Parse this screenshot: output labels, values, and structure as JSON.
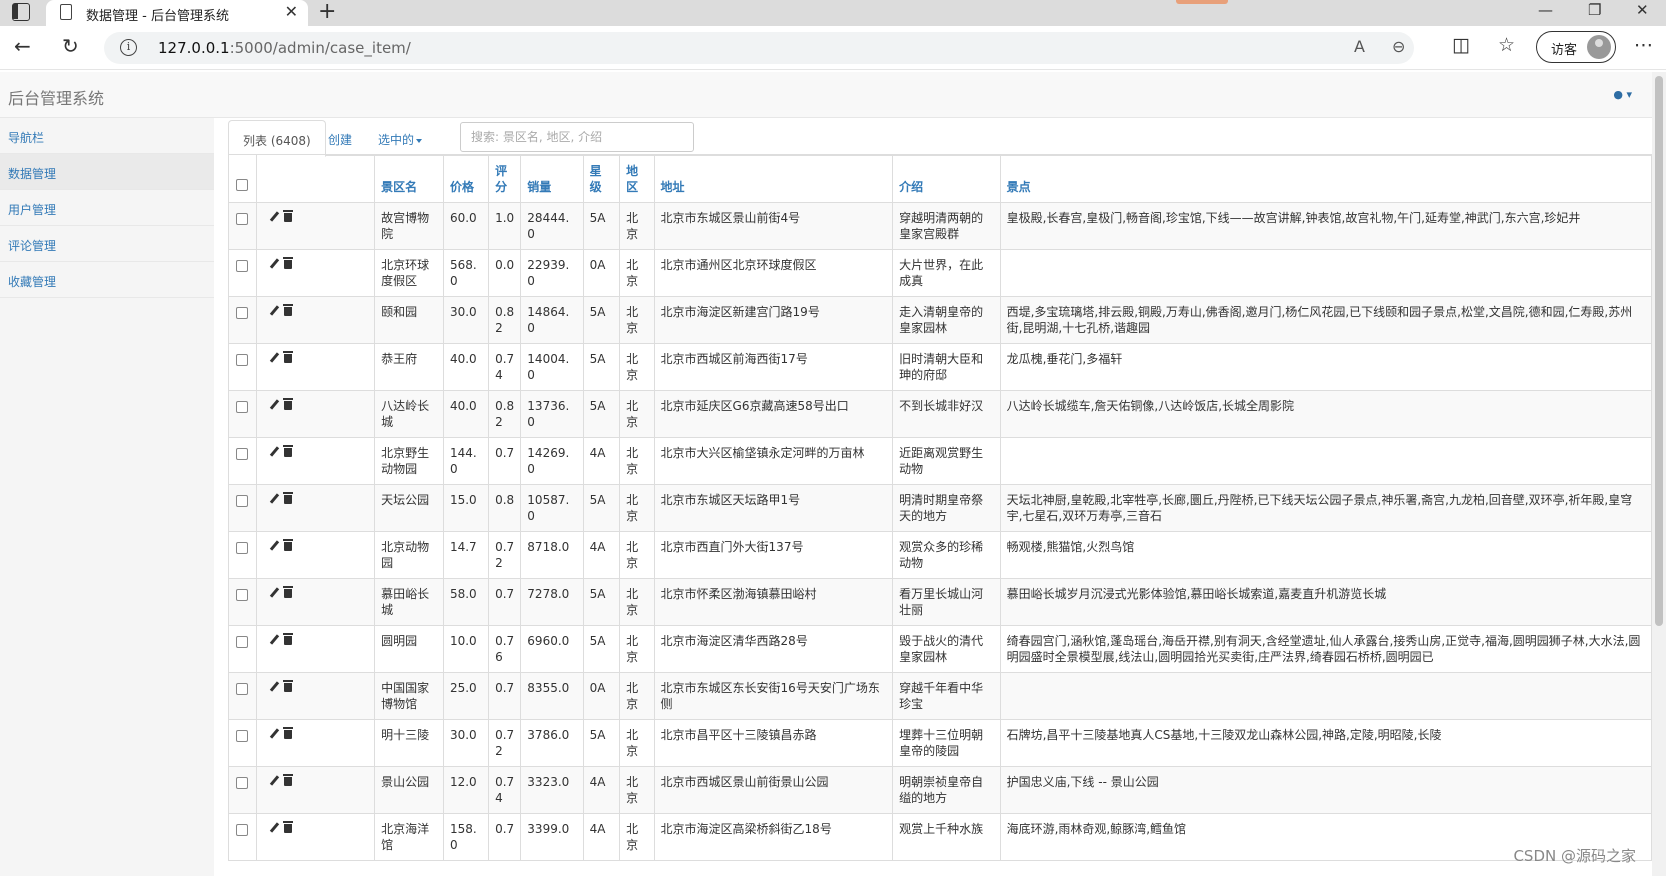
{
  "browser": {
    "tab_title": "数据管理 - 后台管理系统",
    "tab_close": "✕",
    "new_tab": "+",
    "url_host": "127.0.0.1",
    "url_path": ":5000/admin/case_item/",
    "guest_label": "访客",
    "icons": [
      "back-icon",
      "refresh-icon",
      "info-icon",
      "read-aloud-icon",
      "zoom-icon",
      "split-screen-icon",
      "favorites-icon",
      "more-icon"
    ]
  },
  "app": {
    "brand": "后台管理系统",
    "sidebar": [
      {
        "label": "导航栏"
      },
      {
        "label": "数据管理"
      },
      {
        "label": "用户管理"
      },
      {
        "label": "评论管理"
      },
      {
        "label": "收藏管理"
      }
    ],
    "tabs": {
      "list": "列表 (6408)",
      "create": "创建",
      "selected": "选中的"
    },
    "search_placeholder": "搜索: 景区名, 地区, 介绍"
  },
  "table": {
    "headers": {
      "name": "景区名",
      "price": "价格",
      "rating": "评分",
      "sales": "销量",
      "level": "星级",
      "region": "地区",
      "address": "地址",
      "intro": "介绍",
      "spots": "景点"
    },
    "rows": [
      {
        "name": "故宫博物院",
        "price": "60.0",
        "rating": "1.0",
        "sales": "28444.0",
        "level": "5A",
        "region": "北京",
        "address": "北京市东城区景山前街4号",
        "intro": "穿越明清两朝的皇家宫殿群",
        "spots": "皇极殿,长春宫,皇极门,畅音阁,珍宝馆,下线——故宫讲解,钟表馆,故宫礼物,午门,延寿堂,神武门,东六宫,珍妃井"
      },
      {
        "name": "北京环球度假区",
        "price": "568.0",
        "rating": "0.0",
        "sales": "22939.0",
        "level": "0A",
        "region": "北京",
        "address": "北京市通州区北京环球度假区",
        "intro": "大片世界，在此成真",
        "spots": ""
      },
      {
        "name": "颐和园",
        "price": "30.0",
        "rating": "0.82",
        "sales": "14864.0",
        "level": "5A",
        "region": "北京",
        "address": "北京市海淀区新建宫门路19号",
        "intro": "走入清朝皇帝的皇家园林",
        "spots": "西堤,多宝琉璃塔,排云殿,铜殿,万寿山,佛香阁,邀月门,杨仁风花园,已下线颐和园子景点,松堂,文昌院,德和园,仁寿殿,苏州街,昆明湖,十七孔桥,谐趣园"
      },
      {
        "name": "恭王府",
        "price": "40.0",
        "rating": "0.74",
        "sales": "14004.0",
        "level": "5A",
        "region": "北京",
        "address": "北京市西城区前海西街17号",
        "intro": "旧时清朝大臣和珅的府邸",
        "spots": "龙瓜槐,垂花门,多福轩"
      },
      {
        "name": "八达岭长城",
        "price": "40.0",
        "rating": "0.82",
        "sales": "13736.0",
        "level": "5A",
        "region": "北京",
        "address": "北京市延庆区G6京藏高速58号出口",
        "intro": "不到长城非好汉",
        "spots": "八达岭长城缆车,詹天佑铜像,八达岭饭店,长城全周影院"
      },
      {
        "name": "北京野生动物园",
        "price": "144.0",
        "rating": "0.7",
        "sales": "14269.0",
        "level": "4A",
        "region": "北京",
        "address": "北京市大兴区榆垡镇永定河畔的万亩林",
        "intro": "近距离观赏野生动物",
        "spots": ""
      },
      {
        "name": "天坛公园",
        "price": "15.0",
        "rating": "0.8",
        "sales": "10587.0",
        "level": "5A",
        "region": "北京",
        "address": "北京市东城区天坛路甲1号",
        "intro": "明清时期皇帝祭天的地方",
        "spots": "天坛北神厨,皇乾殿,北宰牲亭,长廊,圜丘,丹陛桥,已下线天坛公园子景点,神乐署,斋宫,九龙柏,回音壁,双环亭,祈年殿,皇穹宇,七星石,双环万寿亭,三音石"
      },
      {
        "name": "北京动物园",
        "price": "14.7",
        "rating": "0.72",
        "sales": "8718.0",
        "level": "4A",
        "region": "北京",
        "address": "北京市西直门外大街137号",
        "intro": "观赏众多的珍稀动物",
        "spots": "畅观楼,熊猫馆,火烈鸟馆"
      },
      {
        "name": "慕田峪长城",
        "price": "58.0",
        "rating": "0.7",
        "sales": "7278.0",
        "level": "5A",
        "region": "北京",
        "address": "北京市怀柔区渤海镇慕田峪村",
        "intro": "看万里长城山河壮丽",
        "spots": "慕田峪长城岁月沉浸式光影体验馆,慕田峪长城索道,嘉麦直升机游览长城"
      },
      {
        "name": "圆明园",
        "price": "10.0",
        "rating": "0.76",
        "sales": "6960.0",
        "level": "5A",
        "region": "北京",
        "address": "北京市海淀区清华西路28号",
        "intro": "毁于战火的清代皇家园林",
        "spots": "绮春园宫门,涵秋馆,蓬岛瑶台,海岳开襟,别有洞天,含经堂遗址,仙人承露台,接秀山房,正觉寺,福海,圆明园狮子林,大水法,圆明园盛时全景模型展,线法山,圆明园拾光买卖街,庄严法界,绮春园石桥桥,圆明园已"
      },
      {
        "name": "中国国家博物馆",
        "price": "25.0",
        "rating": "0.7",
        "sales": "8355.0",
        "level": "0A",
        "region": "北京",
        "address": "北京市东城区东长安街16号天安门广场东侧",
        "intro": "穿越千年看中华珍宝",
        "spots": ""
      },
      {
        "name": "明十三陵",
        "price": "30.0",
        "rating": "0.72",
        "sales": "3786.0",
        "level": "5A",
        "region": "北京",
        "address": "北京市昌平区十三陵镇昌赤路",
        "intro": "埋葬十三位明朝皇帝的陵园",
        "spots": "石牌坊,昌平十三陵基地真人CS基地,十三陵双龙山森林公园,神路,定陵,明昭陵,长陵"
      },
      {
        "name": "景山公园",
        "price": "12.0",
        "rating": "0.74",
        "sales": "3323.0",
        "level": "4A",
        "region": "北京",
        "address": "北京市西城区景山前街景山公园",
        "intro": "明朝崇祯皇帝自缢的地方",
        "spots": "护国忠义庙,下线 -- 景山公园"
      },
      {
        "name": "北京海洋馆",
        "price": "158.0",
        "rating": "0.7",
        "sales": "3399.0",
        "level": "4A",
        "region": "北京",
        "address": "北京市海淀区高梁桥斜街乙18号",
        "intro": "观赏上千种水族",
        "spots": "海底环游,雨林奇观,鲸豚湾,鳕鱼馆"
      }
    ]
  },
  "watermark": "CSDN @源码之家"
}
